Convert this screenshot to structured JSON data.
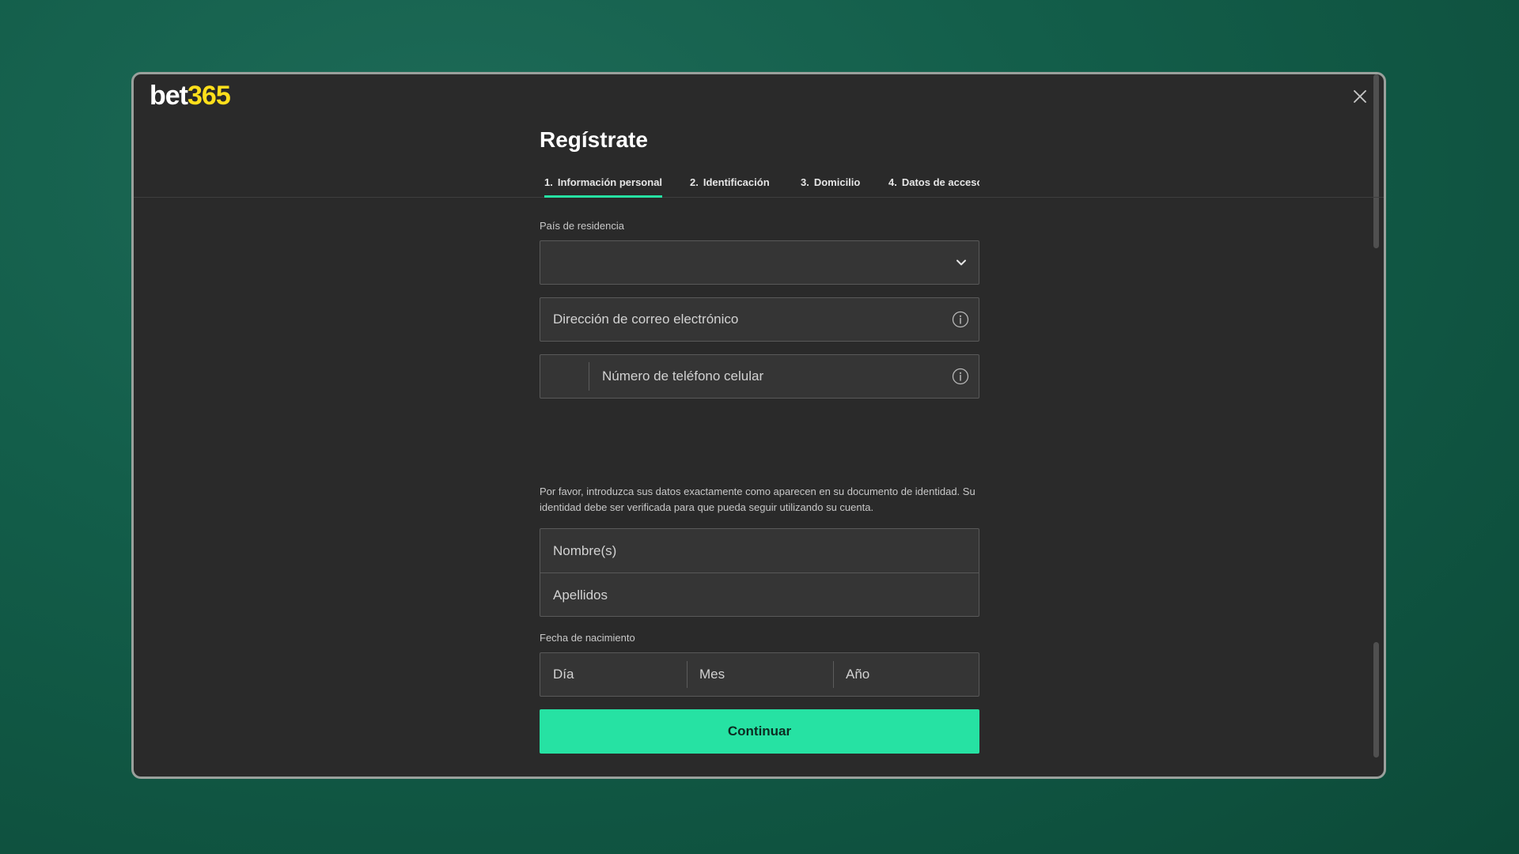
{
  "brand": {
    "logo_part1": "bet",
    "logo_part2": "365",
    "logo_color_main": "#ffffff",
    "logo_color_accent": "#ffdf1b"
  },
  "header": {
    "title": "Regístrate",
    "close_icon": "close-icon"
  },
  "tabs": [
    {
      "num": "1.",
      "label": "Información personal",
      "active": true
    },
    {
      "num": "2.",
      "label": "Identificación",
      "active": false
    },
    {
      "num": "3.",
      "label": "Domicilio",
      "active": false
    },
    {
      "num": "4.",
      "label": "Datos de acceso",
      "active": false
    }
  ],
  "form": {
    "country": {
      "label": "País de residencia",
      "value": "",
      "icon": "chevron-down-icon"
    },
    "email": {
      "placeholder": "Dirección de correo electrónico",
      "icon": "info-icon"
    },
    "phone": {
      "prefix": "",
      "placeholder": "Número de teléfono celular",
      "icon": "info-icon"
    },
    "help_text": "Por favor, introduzca sus datos exactamente como aparecen en su documento de identidad. Su identidad debe ser verificada para que pueda seguir utilizando su cuenta.",
    "first_name": {
      "placeholder": "Nombre(s)"
    },
    "last_name": {
      "placeholder": "Apellidos"
    },
    "dob": {
      "label": "Fecha de nacimiento",
      "day": "Día",
      "month": "Mes",
      "year": "Año"
    },
    "continue_label": "Continuar"
  },
  "colors": {
    "accent": "#26e2a3",
    "modal_bg": "#2a2a2a",
    "field_bg": "#353535"
  }
}
